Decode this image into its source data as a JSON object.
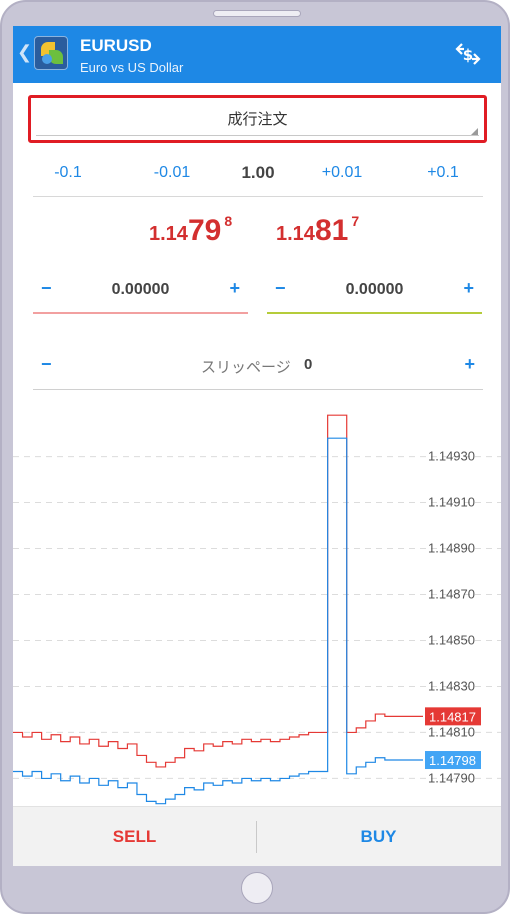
{
  "header": {
    "symbol": "EURUSD",
    "description": "Euro vs US Dollar",
    "back_icon": "chevron-left-icon",
    "trade_icon": "trade-exchange-icon"
  },
  "order": {
    "type": "成行注文"
  },
  "volume": {
    "minus_big": "-0.1",
    "minus_small": "-0.01",
    "value": "1.00",
    "plus_small": "+0.01",
    "plus_big": "+0.1"
  },
  "prices": {
    "sell": {
      "prefix": "1.14",
      "main": "79",
      "super": "8"
    },
    "buy": {
      "prefix": "1.14",
      "main": "81",
      "super": "7"
    }
  },
  "stop_loss": {
    "value": "0.00000",
    "minus": "−",
    "plus": "+"
  },
  "take_profit": {
    "value": "0.00000",
    "minus": "−",
    "plus": "+"
  },
  "slippage": {
    "label": "スリッページ",
    "value": "0",
    "minus": "−",
    "plus": "+"
  },
  "chart_data": {
    "type": "line",
    "y_ticks": [
      "1.14930",
      "1.14910",
      "1.14890",
      "1.14870",
      "1.14850",
      "1.14830",
      "1.14810",
      "1.14790"
    ],
    "ylim": [
      1.14778,
      1.14952
    ],
    "series": [
      {
        "color": "#e53935",
        "values": [
          1.1481,
          1.14808,
          1.1481,
          1.14807,
          1.14809,
          1.14806,
          1.14808,
          1.14805,
          1.14807,
          1.14804,
          1.14806,
          1.14803,
          1.14805,
          1.148,
          1.14797,
          1.14795,
          1.14797,
          1.14799,
          1.14803,
          1.14802,
          1.14805,
          1.14804,
          1.14806,
          1.14805,
          1.14807,
          1.14806,
          1.14807,
          1.14806,
          1.14807,
          1.14808,
          1.14809,
          1.1481,
          1.1481,
          1.14948,
          1.14948,
          1.1481,
          1.14812,
          1.14815,
          1.14818,
          1.14817,
          1.14817,
          1.14817,
          1.14817,
          1.14817
        ]
      },
      {
        "color": "#1e88e5",
        "values": [
          1.14793,
          1.14791,
          1.14793,
          1.1479,
          1.14792,
          1.14789,
          1.14791,
          1.14788,
          1.1479,
          1.14787,
          1.14789,
          1.14786,
          1.14788,
          1.14783,
          1.1478,
          1.14779,
          1.14781,
          1.14783,
          1.14786,
          1.14785,
          1.14788,
          1.14787,
          1.14789,
          1.14788,
          1.1479,
          1.14789,
          1.1479,
          1.14789,
          1.1479,
          1.14791,
          1.14792,
          1.14793,
          1.14793,
          1.14938,
          1.14938,
          1.14792,
          1.14795,
          1.14797,
          1.14799,
          1.14798,
          1.14798,
          1.14798,
          1.14798,
          1.14798
        ]
      }
    ],
    "markers": [
      {
        "label": "1.14817",
        "value": 1.14817,
        "color": "#e53935"
      },
      {
        "label": "1.14798",
        "value": 1.14798,
        "color": "#42a5f5"
      }
    ],
    "grid": true
  },
  "actions": {
    "sell_label": "SELL",
    "buy_label": "BUY",
    "sell_color": "#e53935",
    "buy_color": "#1e88e5"
  }
}
